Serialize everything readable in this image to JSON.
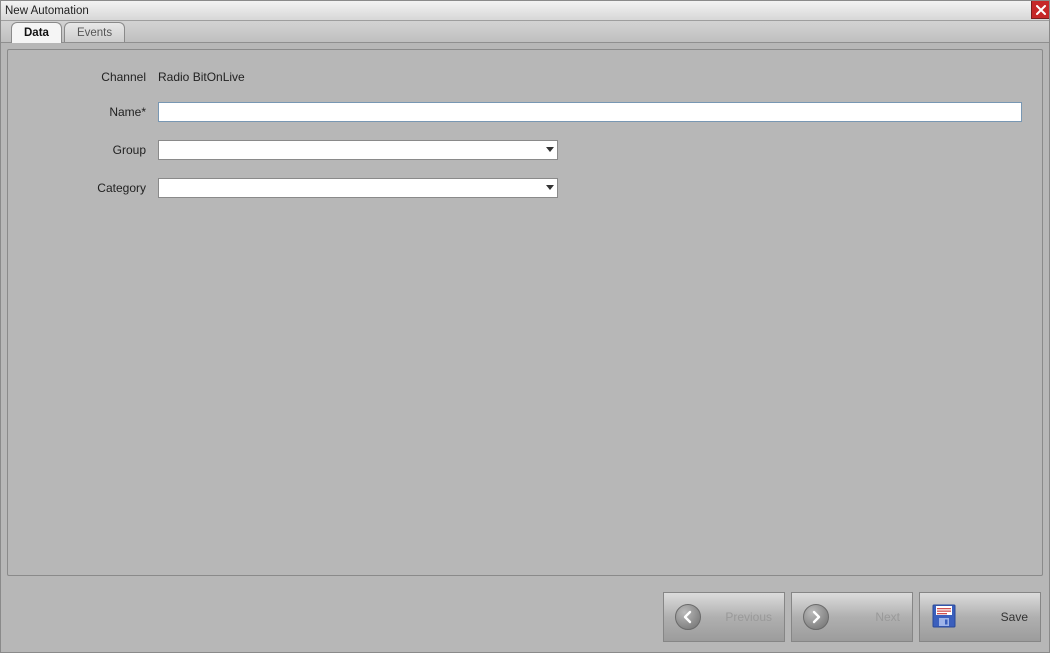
{
  "window": {
    "title": "New Automation"
  },
  "tabs": {
    "data": "Data",
    "events": "Events"
  },
  "form": {
    "channel_label": "Channel",
    "channel_value": "Radio BitOnLive",
    "name_label": "Name*",
    "name_value": "",
    "group_label": "Group",
    "group_value": "",
    "category_label": "Category",
    "category_value": ""
  },
  "buttons": {
    "previous": "Previous",
    "next": "Next",
    "save": "Save"
  }
}
